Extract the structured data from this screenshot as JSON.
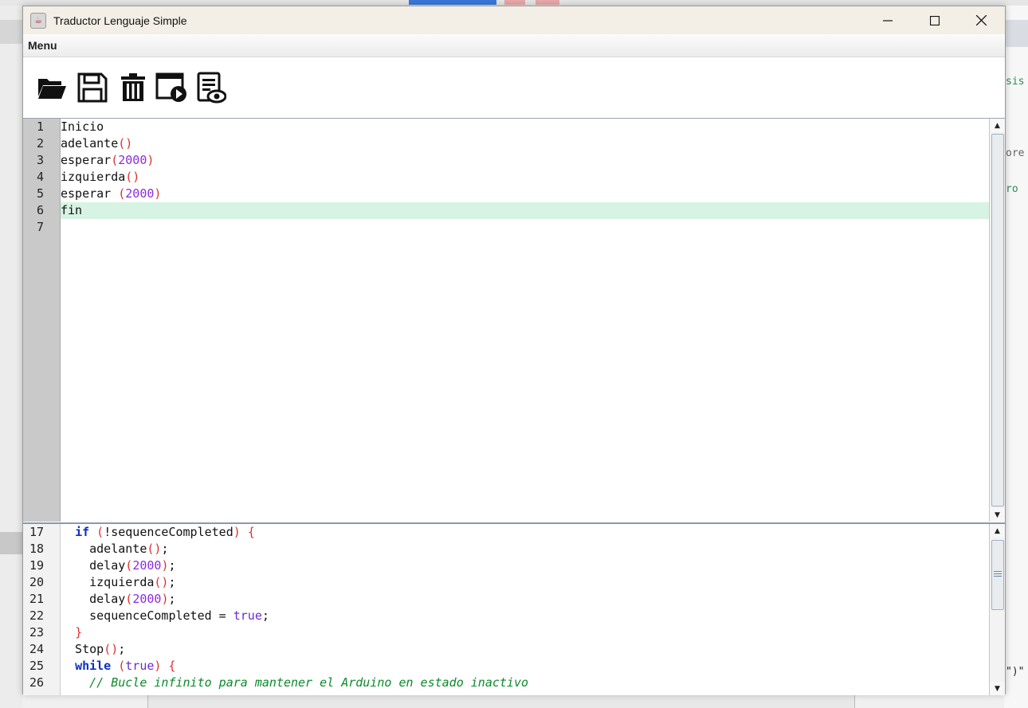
{
  "window": {
    "title": "Traductor Lenguaje Simple",
    "controls": {
      "minimize": "—",
      "maximize": "☐",
      "close": "✕"
    }
  },
  "menu": {
    "items": [
      "Menu"
    ]
  },
  "toolbar": {
    "buttons": [
      {
        "name": "open-folder",
        "icon": "folder-open-icon"
      },
      {
        "name": "save",
        "icon": "floppy-disk-icon"
      },
      {
        "name": "delete",
        "icon": "trash-icon"
      },
      {
        "name": "run",
        "icon": "window-play-icon"
      },
      {
        "name": "view-output",
        "icon": "document-eye-icon"
      }
    ]
  },
  "source_editor": {
    "lines": [
      {
        "n": "1",
        "segs": [
          {
            "t": "Inicio",
            "c": ""
          }
        ]
      },
      {
        "n": "2",
        "segs": [
          {
            "t": "adelante",
            "c": ""
          },
          {
            "t": "()",
            "c": "p"
          }
        ]
      },
      {
        "n": "3",
        "segs": [
          {
            "t": "esperar",
            "c": ""
          },
          {
            "t": "(",
            "c": "p"
          },
          {
            "t": "2000",
            "c": "n"
          },
          {
            "t": ")",
            "c": "p"
          }
        ]
      },
      {
        "n": "4",
        "segs": [
          {
            "t": "izquierda",
            "c": ""
          },
          {
            "t": "()",
            "c": "p"
          }
        ]
      },
      {
        "n": "5",
        "segs": [
          {
            "t": "esperar ",
            "c": ""
          },
          {
            "t": "(",
            "c": "p"
          },
          {
            "t": "2000",
            "c": "n"
          },
          {
            "t": ")",
            "c": "p"
          }
        ]
      },
      {
        "n": "6",
        "segs": [
          {
            "t": "fin",
            "c": ""
          }
        ]
      },
      {
        "n": "7",
        "segs": []
      }
    ],
    "highlighted_line": 6
  },
  "output_editor": {
    "lines": [
      {
        "n": "17",
        "segs": [
          {
            "t": "  ",
            "c": ""
          },
          {
            "t": "if",
            "c": "kw"
          },
          {
            "t": " ",
            "c": ""
          },
          {
            "t": "(",
            "c": "p"
          },
          {
            "t": "!sequenceCompleted",
            "c": ""
          },
          {
            "t": ")",
            "c": "p"
          },
          {
            "t": " ",
            "c": ""
          },
          {
            "t": "{",
            "c": "p"
          }
        ]
      },
      {
        "n": "18",
        "segs": [
          {
            "t": "    adelante",
            "c": ""
          },
          {
            "t": "()",
            "c": "p"
          },
          {
            "t": ";",
            "c": ""
          }
        ]
      },
      {
        "n": "19",
        "segs": [
          {
            "t": "    delay",
            "c": ""
          },
          {
            "t": "(",
            "c": "p"
          },
          {
            "t": "2000",
            "c": "n"
          },
          {
            "t": ")",
            "c": "p"
          },
          {
            "t": ";",
            "c": ""
          }
        ]
      },
      {
        "n": "20",
        "segs": [
          {
            "t": "    izquierda",
            "c": ""
          },
          {
            "t": "()",
            "c": "p"
          },
          {
            "t": ";",
            "c": ""
          }
        ]
      },
      {
        "n": "21",
        "segs": [
          {
            "t": "    delay",
            "c": ""
          },
          {
            "t": "(",
            "c": "p"
          },
          {
            "t": "2000",
            "c": "n"
          },
          {
            "t": ")",
            "c": "p"
          },
          {
            "t": ";",
            "c": ""
          }
        ]
      },
      {
        "n": "22",
        "segs": [
          {
            "t": "    sequenceCompleted = ",
            "c": ""
          },
          {
            "t": "true",
            "c": "vl"
          },
          {
            "t": ";",
            "c": ""
          }
        ]
      },
      {
        "n": "23",
        "segs": [
          {
            "t": "  ",
            "c": ""
          },
          {
            "t": "}",
            "c": "p"
          }
        ]
      },
      {
        "n": "24",
        "segs": [
          {
            "t": "  Stop",
            "c": ""
          },
          {
            "t": "()",
            "c": "p"
          },
          {
            "t": ";",
            "c": ""
          }
        ]
      },
      {
        "n": "25",
        "segs": [
          {
            "t": "  ",
            "c": ""
          },
          {
            "t": "while",
            "c": "kw"
          },
          {
            "t": " ",
            "c": ""
          },
          {
            "t": "(",
            "c": "p"
          },
          {
            "t": "true",
            "c": "vl"
          },
          {
            "t": ")",
            "c": "p"
          },
          {
            "t": " ",
            "c": ""
          },
          {
            "t": "{",
            "c": "p"
          }
        ]
      },
      {
        "n": "26",
        "segs": [
          {
            "t": "    ",
            "c": ""
          },
          {
            "t": "// Bucle infinito para mantener el Arduino en estado inactivo",
            "c": "cm"
          }
        ]
      }
    ]
  },
  "background_fragments": {
    "right_texts": [
      "sis",
      "ore",
      "ro",
      "\")\""
    ]
  },
  "colors": {
    "highlight": "#d7f3e3",
    "keyword": "#0a2fc8",
    "paren": "#e03030",
    "number": "#8a2be2",
    "comment": "#0a8a2a"
  }
}
